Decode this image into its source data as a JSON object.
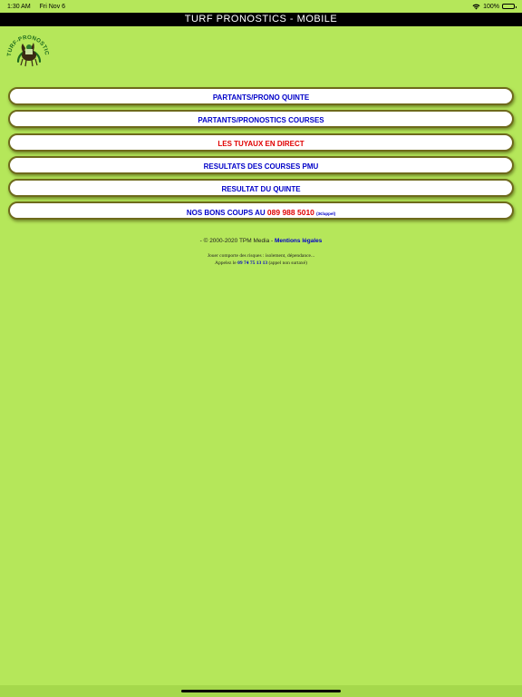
{
  "status_bar": {
    "time": "1:30 AM",
    "date": "Fri Nov 6",
    "battery": "100%"
  },
  "title": "TURF PRONOSTICS - MOBILE",
  "logo_text": "TURF-PRONOSTICS",
  "menu": {
    "partants_prono_quinte": "PARTANTS/PRONO QUINTE",
    "partants_pronostics_courses": "PARTANTS/PRONOSTICS COURSES",
    "tuyaux_direct": "LES TUYAUX EN DIRECT",
    "resultats_courses": "RESULTATS DES COURSES PMU",
    "resultat_quinte": "RESULTAT DU QUINTE",
    "bons_coups_prefix": "NOS BONS COUPS AU",
    "bons_coups_phone": "089 988 5010",
    "bons_coups_price": "(3€/appel)"
  },
  "footer": {
    "copyright": "- © 2000-2020 TPM Media -",
    "legal_link": "Mentions légales",
    "warning_line1": "Jouer comporte des risques : isolement, dépendance...",
    "warning_prefix": "Appelez le",
    "warning_number": "09 74 75 13 13",
    "warning_suffix": "(appel non surtaxé)"
  },
  "colors": {
    "background": "#b5e75a",
    "link_blue": "#0000c8",
    "alert_red": "#e00000"
  }
}
